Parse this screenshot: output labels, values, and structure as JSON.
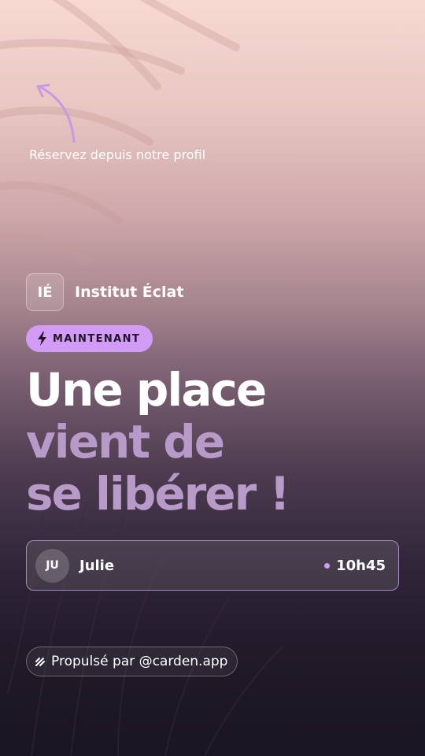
{
  "profile_hint": {
    "text": "Réservez depuis notre profil"
  },
  "brand": {
    "initials": "IÉ",
    "name": "Institut Éclat"
  },
  "badge": {
    "icon": "lightning-icon",
    "label": "MAINTENANT"
  },
  "headline": {
    "line1": "Une place",
    "line2": "vient de",
    "line3": "se libérer !"
  },
  "slot": {
    "avatar_initials": "JU",
    "person_name": "Julie",
    "time": "10h45"
  },
  "footer": {
    "icon": "carden-logo-icon",
    "label": "Propulsé par @carden.app"
  },
  "colors": {
    "accent": "#d29bf5",
    "headline_muted": "#b89ac8",
    "background_top": "#f7d9d2",
    "background_bottom": "#1a1522"
  }
}
